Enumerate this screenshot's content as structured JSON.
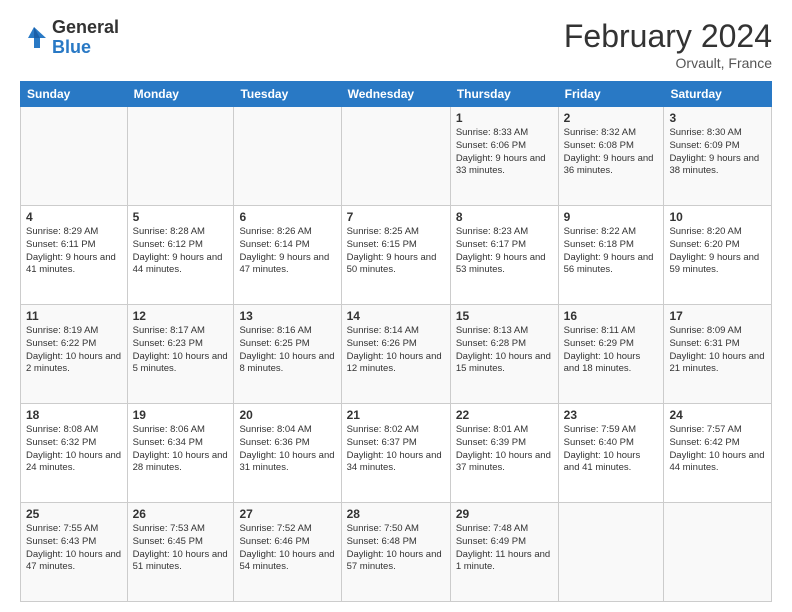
{
  "header": {
    "logo_general": "General",
    "logo_blue": "Blue",
    "month_title": "February 2024",
    "location": "Orvault, France"
  },
  "days_of_week": [
    "Sunday",
    "Monday",
    "Tuesday",
    "Wednesday",
    "Thursday",
    "Friday",
    "Saturday"
  ],
  "weeks": [
    [
      {
        "day": "",
        "info": ""
      },
      {
        "day": "",
        "info": ""
      },
      {
        "day": "",
        "info": ""
      },
      {
        "day": "",
        "info": ""
      },
      {
        "day": "1",
        "info": "Sunrise: 8:33 AM\nSunset: 6:06 PM\nDaylight: 9 hours\nand 33 minutes."
      },
      {
        "day": "2",
        "info": "Sunrise: 8:32 AM\nSunset: 6:08 PM\nDaylight: 9 hours\nand 36 minutes."
      },
      {
        "day": "3",
        "info": "Sunrise: 8:30 AM\nSunset: 6:09 PM\nDaylight: 9 hours\nand 38 minutes."
      }
    ],
    [
      {
        "day": "4",
        "info": "Sunrise: 8:29 AM\nSunset: 6:11 PM\nDaylight: 9 hours\nand 41 minutes."
      },
      {
        "day": "5",
        "info": "Sunrise: 8:28 AM\nSunset: 6:12 PM\nDaylight: 9 hours\nand 44 minutes."
      },
      {
        "day": "6",
        "info": "Sunrise: 8:26 AM\nSunset: 6:14 PM\nDaylight: 9 hours\nand 47 minutes."
      },
      {
        "day": "7",
        "info": "Sunrise: 8:25 AM\nSunset: 6:15 PM\nDaylight: 9 hours\nand 50 minutes."
      },
      {
        "day": "8",
        "info": "Sunrise: 8:23 AM\nSunset: 6:17 PM\nDaylight: 9 hours\nand 53 minutes."
      },
      {
        "day": "9",
        "info": "Sunrise: 8:22 AM\nSunset: 6:18 PM\nDaylight: 9 hours\nand 56 minutes."
      },
      {
        "day": "10",
        "info": "Sunrise: 8:20 AM\nSunset: 6:20 PM\nDaylight: 9 hours\nand 59 minutes."
      }
    ],
    [
      {
        "day": "11",
        "info": "Sunrise: 8:19 AM\nSunset: 6:22 PM\nDaylight: 10 hours\nand 2 minutes."
      },
      {
        "day": "12",
        "info": "Sunrise: 8:17 AM\nSunset: 6:23 PM\nDaylight: 10 hours\nand 5 minutes."
      },
      {
        "day": "13",
        "info": "Sunrise: 8:16 AM\nSunset: 6:25 PM\nDaylight: 10 hours\nand 8 minutes."
      },
      {
        "day": "14",
        "info": "Sunrise: 8:14 AM\nSunset: 6:26 PM\nDaylight: 10 hours\nand 12 minutes."
      },
      {
        "day": "15",
        "info": "Sunrise: 8:13 AM\nSunset: 6:28 PM\nDaylight: 10 hours\nand 15 minutes."
      },
      {
        "day": "16",
        "info": "Sunrise: 8:11 AM\nSunset: 6:29 PM\nDaylight: 10 hours\nand 18 minutes."
      },
      {
        "day": "17",
        "info": "Sunrise: 8:09 AM\nSunset: 6:31 PM\nDaylight: 10 hours\nand 21 minutes."
      }
    ],
    [
      {
        "day": "18",
        "info": "Sunrise: 8:08 AM\nSunset: 6:32 PM\nDaylight: 10 hours\nand 24 minutes."
      },
      {
        "day": "19",
        "info": "Sunrise: 8:06 AM\nSunset: 6:34 PM\nDaylight: 10 hours\nand 28 minutes."
      },
      {
        "day": "20",
        "info": "Sunrise: 8:04 AM\nSunset: 6:36 PM\nDaylight: 10 hours\nand 31 minutes."
      },
      {
        "day": "21",
        "info": "Sunrise: 8:02 AM\nSunset: 6:37 PM\nDaylight: 10 hours\nand 34 minutes."
      },
      {
        "day": "22",
        "info": "Sunrise: 8:01 AM\nSunset: 6:39 PM\nDaylight: 10 hours\nand 37 minutes."
      },
      {
        "day": "23",
        "info": "Sunrise: 7:59 AM\nSunset: 6:40 PM\nDaylight: 10 hours\nand 41 minutes."
      },
      {
        "day": "24",
        "info": "Sunrise: 7:57 AM\nSunset: 6:42 PM\nDaylight: 10 hours\nand 44 minutes."
      }
    ],
    [
      {
        "day": "25",
        "info": "Sunrise: 7:55 AM\nSunset: 6:43 PM\nDaylight: 10 hours\nand 47 minutes."
      },
      {
        "day": "26",
        "info": "Sunrise: 7:53 AM\nSunset: 6:45 PM\nDaylight: 10 hours\nand 51 minutes."
      },
      {
        "day": "27",
        "info": "Sunrise: 7:52 AM\nSunset: 6:46 PM\nDaylight: 10 hours\nand 54 minutes."
      },
      {
        "day": "28",
        "info": "Sunrise: 7:50 AM\nSunset: 6:48 PM\nDaylight: 10 hours\nand 57 minutes."
      },
      {
        "day": "29",
        "info": "Sunrise: 7:48 AM\nSunset: 6:49 PM\nDaylight: 11 hours\nand 1 minute."
      },
      {
        "day": "",
        "info": ""
      },
      {
        "day": "",
        "info": ""
      }
    ]
  ]
}
